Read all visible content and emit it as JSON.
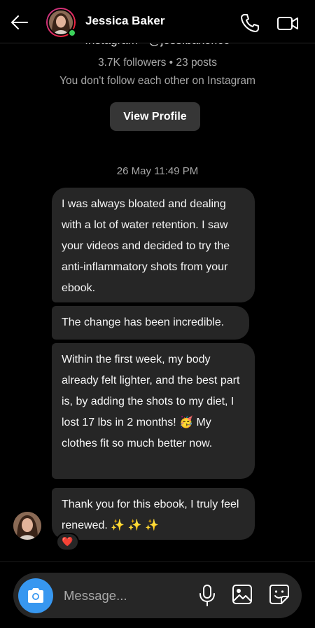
{
  "header": {
    "contact_name": "Jessica Baker"
  },
  "profile": {
    "partial_line": "Instagram • @jess.baker.co",
    "stats": "3.7K followers • 23 posts",
    "follow_note": "You don't follow each other on Instagram",
    "view_profile_label": "View Profile"
  },
  "conversation": {
    "timestamp": "26 May 11:49 PM",
    "messages": [
      {
        "text": "I was always bloated and dealing with a lot of water retention. I saw your videos and decided to try the anti-inflammatory shots from your ebook."
      },
      {
        "text": "The change has been incredible."
      },
      {
        "text": "Within the first week, my body already felt lighter, and the best part is, by adding the shots to my diet, I lost 17 lbs in 2 months! 🥳 My clothes fit so much better now."
      },
      {
        "text": "Thank you for this ebook, I truly feel renewed. ✨ ✨ ✨"
      }
    ],
    "reaction": "❤️"
  },
  "composer": {
    "placeholder": "Message..."
  },
  "icons": {
    "back": "arrow-left-icon",
    "call": "phone-icon",
    "video": "video-camera-icon",
    "camera": "camera-icon",
    "mic": "microphone-icon",
    "gallery": "image-icon",
    "sticker": "sticker-icon"
  },
  "colors": {
    "background": "#000000",
    "bubble": "#262626",
    "accent_blue": "#3797f0",
    "online_green": "#3cd35b"
  }
}
